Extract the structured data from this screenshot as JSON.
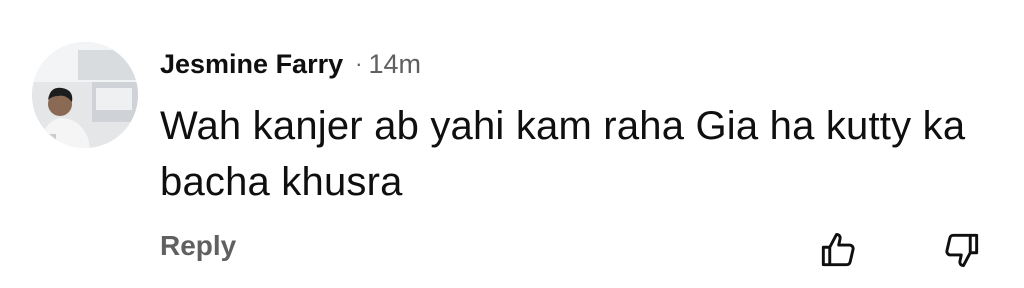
{
  "comment": {
    "author": "Jesmine Farry",
    "separator": "·",
    "time": "14m",
    "text": "Wah kanjer ab yahi kam raha Gia ha kutty ka bacha khusra",
    "reply_label": "Reply"
  },
  "icons": {
    "like": "thumbs-up-icon",
    "dislike": "thumbs-down-icon"
  },
  "colors": {
    "primary_text": "#0f0f0f",
    "secondary_text": "#606060"
  }
}
